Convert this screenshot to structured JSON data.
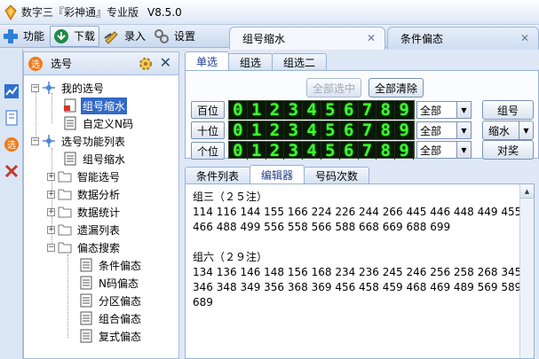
{
  "window": {
    "title": "数字三『彩神通』专业版",
    "version": "V8.5.0"
  },
  "toolbar": {
    "items": [
      {
        "label": "功能",
        "icon": "plus-icon"
      },
      {
        "label": "下载",
        "icon": "download-icon"
      },
      {
        "label": "录入",
        "icon": "pen-icon"
      },
      {
        "label": "设置",
        "icon": "gear-icon"
      }
    ]
  },
  "doc_tabs": {
    "active": "组号缩水",
    "inactive": "条件偏态"
  },
  "panel": {
    "title": "选号",
    "tree": {
      "my_root": "我的选号",
      "my_items": [
        "组号缩水",
        "自定义N码"
      ],
      "func_root": "选号功能列表",
      "func_items": [
        "组号缩水",
        "智能选号",
        "数据分析",
        "数据统计",
        "遗漏列表",
        "偏态搜索"
      ],
      "bias_items": [
        "条件偏态",
        "N码偏态",
        "分区偏态",
        "组合偏态",
        "复式偏态"
      ]
    }
  },
  "selector": {
    "tabs": [
      "单选",
      "组选",
      "组选二"
    ],
    "select_all": "全部选中",
    "clear_all": "全部清除",
    "rows": [
      {
        "label": "百位",
        "filter": "全部"
      },
      {
        "label": "十位",
        "filter": "全部"
      },
      {
        "label": "个位",
        "filter": "全部"
      }
    ],
    "digits": [
      "0",
      "1",
      "2",
      "3",
      "4",
      "5",
      "6",
      "7",
      "8",
      "9"
    ],
    "actions": {
      "group": "组号",
      "shrink": "缩水",
      "prize": "对奖"
    }
  },
  "editor": {
    "tabs": [
      "条件列表",
      "编辑器",
      "号码次数"
    ],
    "group3_header": "组三（２５注）",
    "group3_lines": [
      "114 116 144 155 166 224 226 244 266 445 446 448 449 455",
      "466 488 499 556 558 566 588 668 669 688 699"
    ],
    "group6_header": "组六（２９注）",
    "group6_lines": [
      "134 136 146 148 156 168 234 236 245 246 256 258 268 345",
      "346 348 349 356 368 369 456 458 459 468 469 489 569 589",
      "689"
    ]
  }
}
